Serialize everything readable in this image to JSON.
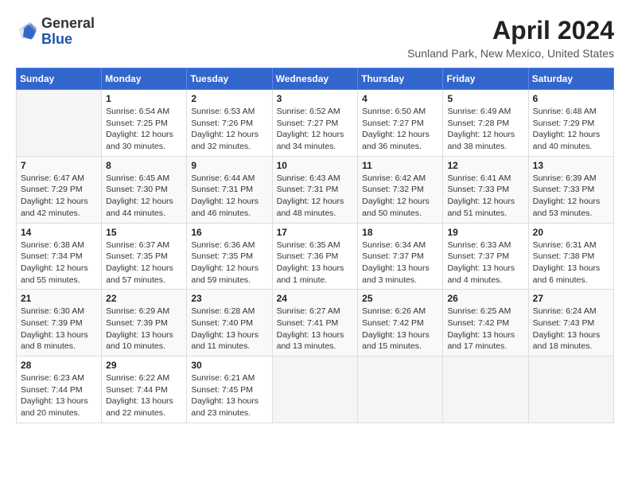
{
  "header": {
    "logo_general": "General",
    "logo_blue": "Blue",
    "month_year": "April 2024",
    "location": "Sunland Park, New Mexico, United States"
  },
  "weekdays": [
    "Sunday",
    "Monday",
    "Tuesday",
    "Wednesday",
    "Thursday",
    "Friday",
    "Saturday"
  ],
  "weeks": [
    [
      {
        "day": "",
        "sunrise": "",
        "sunset": "",
        "daylight": ""
      },
      {
        "day": "1",
        "sunrise": "Sunrise: 6:54 AM",
        "sunset": "Sunset: 7:25 PM",
        "daylight": "Daylight: 12 hours and 30 minutes."
      },
      {
        "day": "2",
        "sunrise": "Sunrise: 6:53 AM",
        "sunset": "Sunset: 7:26 PM",
        "daylight": "Daylight: 12 hours and 32 minutes."
      },
      {
        "day": "3",
        "sunrise": "Sunrise: 6:52 AM",
        "sunset": "Sunset: 7:27 PM",
        "daylight": "Daylight: 12 hours and 34 minutes."
      },
      {
        "day": "4",
        "sunrise": "Sunrise: 6:50 AM",
        "sunset": "Sunset: 7:27 PM",
        "daylight": "Daylight: 12 hours and 36 minutes."
      },
      {
        "day": "5",
        "sunrise": "Sunrise: 6:49 AM",
        "sunset": "Sunset: 7:28 PM",
        "daylight": "Daylight: 12 hours and 38 minutes."
      },
      {
        "day": "6",
        "sunrise": "Sunrise: 6:48 AM",
        "sunset": "Sunset: 7:29 PM",
        "daylight": "Daylight: 12 hours and 40 minutes."
      }
    ],
    [
      {
        "day": "7",
        "sunrise": "Sunrise: 6:47 AM",
        "sunset": "Sunset: 7:29 PM",
        "daylight": "Daylight: 12 hours and 42 minutes."
      },
      {
        "day": "8",
        "sunrise": "Sunrise: 6:45 AM",
        "sunset": "Sunset: 7:30 PM",
        "daylight": "Daylight: 12 hours and 44 minutes."
      },
      {
        "day": "9",
        "sunrise": "Sunrise: 6:44 AM",
        "sunset": "Sunset: 7:31 PM",
        "daylight": "Daylight: 12 hours and 46 minutes."
      },
      {
        "day": "10",
        "sunrise": "Sunrise: 6:43 AM",
        "sunset": "Sunset: 7:31 PM",
        "daylight": "Daylight: 12 hours and 48 minutes."
      },
      {
        "day": "11",
        "sunrise": "Sunrise: 6:42 AM",
        "sunset": "Sunset: 7:32 PM",
        "daylight": "Daylight: 12 hours and 50 minutes."
      },
      {
        "day": "12",
        "sunrise": "Sunrise: 6:41 AM",
        "sunset": "Sunset: 7:33 PM",
        "daylight": "Daylight: 12 hours and 51 minutes."
      },
      {
        "day": "13",
        "sunrise": "Sunrise: 6:39 AM",
        "sunset": "Sunset: 7:33 PM",
        "daylight": "Daylight: 12 hours and 53 minutes."
      }
    ],
    [
      {
        "day": "14",
        "sunrise": "Sunrise: 6:38 AM",
        "sunset": "Sunset: 7:34 PM",
        "daylight": "Daylight: 12 hours and 55 minutes."
      },
      {
        "day": "15",
        "sunrise": "Sunrise: 6:37 AM",
        "sunset": "Sunset: 7:35 PM",
        "daylight": "Daylight: 12 hours and 57 minutes."
      },
      {
        "day": "16",
        "sunrise": "Sunrise: 6:36 AM",
        "sunset": "Sunset: 7:35 PM",
        "daylight": "Daylight: 12 hours and 59 minutes."
      },
      {
        "day": "17",
        "sunrise": "Sunrise: 6:35 AM",
        "sunset": "Sunset: 7:36 PM",
        "daylight": "Daylight: 13 hours and 1 minute."
      },
      {
        "day": "18",
        "sunrise": "Sunrise: 6:34 AM",
        "sunset": "Sunset: 7:37 PM",
        "daylight": "Daylight: 13 hours and 3 minutes."
      },
      {
        "day": "19",
        "sunrise": "Sunrise: 6:33 AM",
        "sunset": "Sunset: 7:37 PM",
        "daylight": "Daylight: 13 hours and 4 minutes."
      },
      {
        "day": "20",
        "sunrise": "Sunrise: 6:31 AM",
        "sunset": "Sunset: 7:38 PM",
        "daylight": "Daylight: 13 hours and 6 minutes."
      }
    ],
    [
      {
        "day": "21",
        "sunrise": "Sunrise: 6:30 AM",
        "sunset": "Sunset: 7:39 PM",
        "daylight": "Daylight: 13 hours and 8 minutes."
      },
      {
        "day": "22",
        "sunrise": "Sunrise: 6:29 AM",
        "sunset": "Sunset: 7:39 PM",
        "daylight": "Daylight: 13 hours and 10 minutes."
      },
      {
        "day": "23",
        "sunrise": "Sunrise: 6:28 AM",
        "sunset": "Sunset: 7:40 PM",
        "daylight": "Daylight: 13 hours and 11 minutes."
      },
      {
        "day": "24",
        "sunrise": "Sunrise: 6:27 AM",
        "sunset": "Sunset: 7:41 PM",
        "daylight": "Daylight: 13 hours and 13 minutes."
      },
      {
        "day": "25",
        "sunrise": "Sunrise: 6:26 AM",
        "sunset": "Sunset: 7:42 PM",
        "daylight": "Daylight: 13 hours and 15 minutes."
      },
      {
        "day": "26",
        "sunrise": "Sunrise: 6:25 AM",
        "sunset": "Sunset: 7:42 PM",
        "daylight": "Daylight: 13 hours and 17 minutes."
      },
      {
        "day": "27",
        "sunrise": "Sunrise: 6:24 AM",
        "sunset": "Sunset: 7:43 PM",
        "daylight": "Daylight: 13 hours and 18 minutes."
      }
    ],
    [
      {
        "day": "28",
        "sunrise": "Sunrise: 6:23 AM",
        "sunset": "Sunset: 7:44 PM",
        "daylight": "Daylight: 13 hours and 20 minutes."
      },
      {
        "day": "29",
        "sunrise": "Sunrise: 6:22 AM",
        "sunset": "Sunset: 7:44 PM",
        "daylight": "Daylight: 13 hours and 22 minutes."
      },
      {
        "day": "30",
        "sunrise": "Sunrise: 6:21 AM",
        "sunset": "Sunset: 7:45 PM",
        "daylight": "Daylight: 13 hours and 23 minutes."
      },
      {
        "day": "",
        "sunrise": "",
        "sunset": "",
        "daylight": ""
      },
      {
        "day": "",
        "sunrise": "",
        "sunset": "",
        "daylight": ""
      },
      {
        "day": "",
        "sunrise": "",
        "sunset": "",
        "daylight": ""
      },
      {
        "day": "",
        "sunrise": "",
        "sunset": "",
        "daylight": ""
      }
    ]
  ]
}
